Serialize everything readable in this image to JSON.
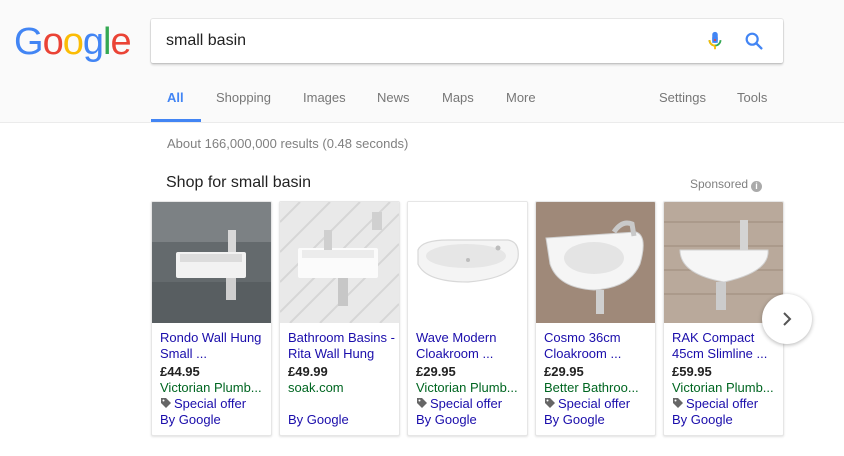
{
  "logo": {
    "letters": [
      "G",
      "o",
      "o",
      "g",
      "l",
      "e"
    ],
    "colors": [
      "#4285f4",
      "#ea4335",
      "#fbbc05",
      "#4285f4",
      "#34a853",
      "#ea4335"
    ]
  },
  "search": {
    "query": "small basin",
    "mic_icon": "mic-icon",
    "search_icon": "search-icon"
  },
  "tabs": {
    "all": "All",
    "shopping": "Shopping",
    "images": "Images",
    "news": "News",
    "maps": "Maps",
    "more": "More",
    "settings": "Settings",
    "tools": "Tools"
  },
  "result_stats": "About 166,000,000 results (0.48 seconds)",
  "shopping": {
    "title": "Shop for small basin",
    "sponsored": "Sponsored",
    "products": [
      {
        "title": "Rondo Wall Hung Small ...",
        "price": "£44.95",
        "merchant": "Victorian Plumb...",
        "offer": "Special offer",
        "source": "By Google"
      },
      {
        "title": "Bathroom Basins - Rita Wall Hung",
        "price": "£49.99",
        "merchant": "soak.com",
        "offer": "",
        "source": "By Google"
      },
      {
        "title": "Wave Modern Cloakroom ...",
        "price": "£29.95",
        "merchant": "Victorian Plumb...",
        "offer": "Special offer",
        "source": "By Google"
      },
      {
        "title": "Cosmo 36cm Cloakroom ...",
        "price": "£29.95",
        "merchant": "Better Bathroo...",
        "offer": "Special offer",
        "source": "By Google"
      },
      {
        "title": "RAK Compact 45cm Slimline ...",
        "price": "£59.95",
        "merchant": "Victorian Plumb...",
        "offer": "Special offer",
        "source": "By Google"
      }
    ]
  },
  "colors": {
    "link": "#1a0dab",
    "merchant": "#006621",
    "accent": "#4285f4"
  }
}
